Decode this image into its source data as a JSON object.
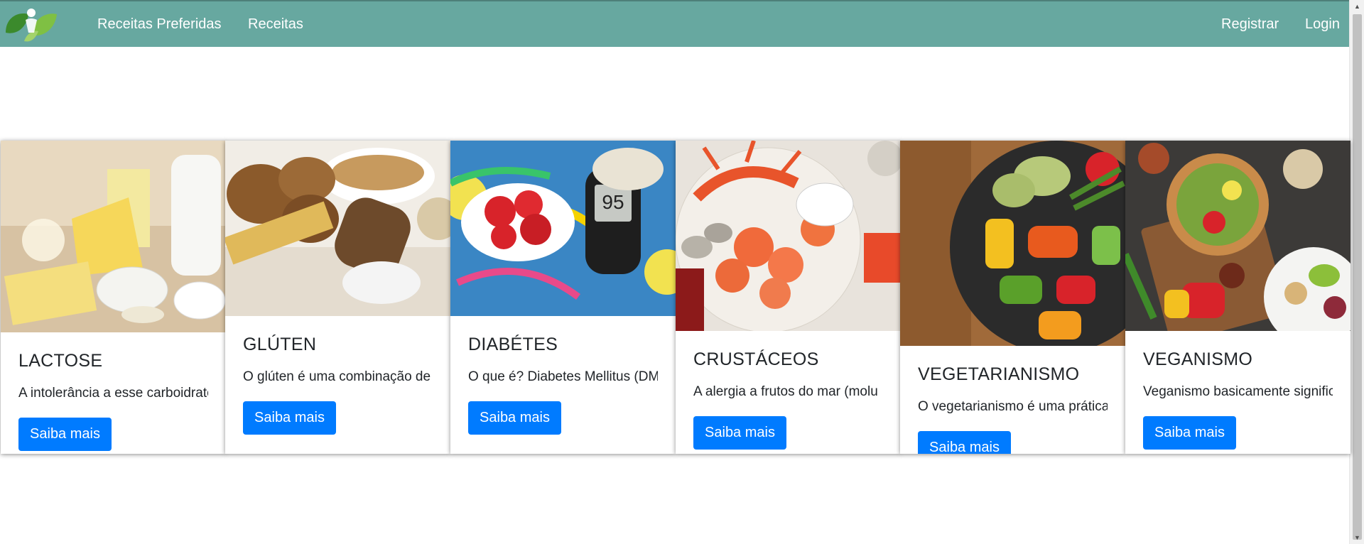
{
  "nav": {
    "links": [
      "Receitas Preferidas",
      "Receitas"
    ],
    "right_links": [
      "Registrar",
      "Login"
    ]
  },
  "colors": {
    "navbar": "#67a8a0",
    "button": "#007bff"
  },
  "cards": [
    {
      "title": "LACTOSE",
      "text": "A intolerância a esse carboidrato",
      "button": "Saiba mais",
      "image": "dairy-products-image"
    },
    {
      "title": "GLÚTEN",
      "text": "O glúten é uma combinação de",
      "button": "Saiba mais",
      "image": "bread-and-grains-image"
    },
    {
      "title": "DIABÉTES",
      "text": "O que é? Diabetes Mellitus (DM)",
      "button": "Saiba mais",
      "image": "glucose-meter-and-fruits-image"
    },
    {
      "title": "CRUSTÁCEOS",
      "text": "A alergia a frutos do mar (molu",
      "button": "Saiba mais",
      "image": "seafood-platter-image"
    },
    {
      "title": "VEGETARIANISMO",
      "text": "O vegetarianismo é uma prática",
      "button": "Saiba mais",
      "image": "grilled-vegetables-image"
    },
    {
      "title": "VEGANISMO",
      "text": "Veganismo basicamente significa",
      "button": "Saiba mais",
      "image": "vegan-bowls-image"
    }
  ]
}
